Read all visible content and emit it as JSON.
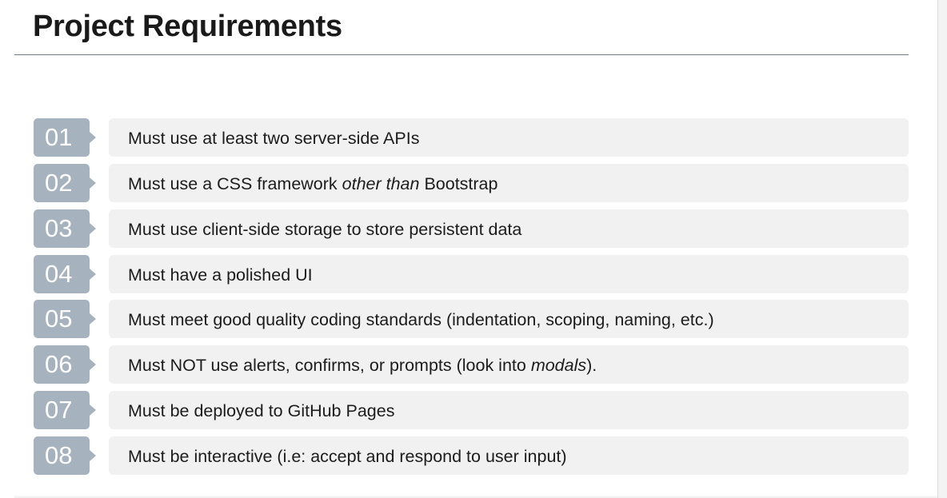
{
  "title": "Project Requirements",
  "items": [
    {
      "number": "01",
      "parts": [
        "Must use at least two server-side APIs",
        "",
        ""
      ]
    },
    {
      "number": "02",
      "parts": [
        "Must use a CSS framework ",
        "other than",
        " Bootstrap"
      ]
    },
    {
      "number": "03",
      "parts": [
        "Must use client-side storage to store persistent data",
        "",
        ""
      ]
    },
    {
      "number": "04",
      "parts": [
        "Must have a polished UI",
        "",
        ""
      ]
    },
    {
      "number": "05",
      "parts": [
        "Must meet good quality coding standards (indentation, scoping, naming, etc.)",
        "",
        ""
      ]
    },
    {
      "number": "06",
      "parts": [
        "Must NOT use alerts, confirms, or prompts (look into ",
        "modals",
        ")."
      ]
    },
    {
      "number": "07",
      "parts": [
        "Must be deployed to GitHub Pages",
        "",
        ""
      ]
    },
    {
      "number": "08",
      "parts": [
        "Must be interactive (i.e: accept and respond to user input)",
        "",
        ""
      ]
    }
  ],
  "colors": {
    "number_badge": "#a6b3bf",
    "item_background": "#f1f1f1",
    "title_rule": "#6e7a85",
    "text": "#1c1c1c"
  }
}
